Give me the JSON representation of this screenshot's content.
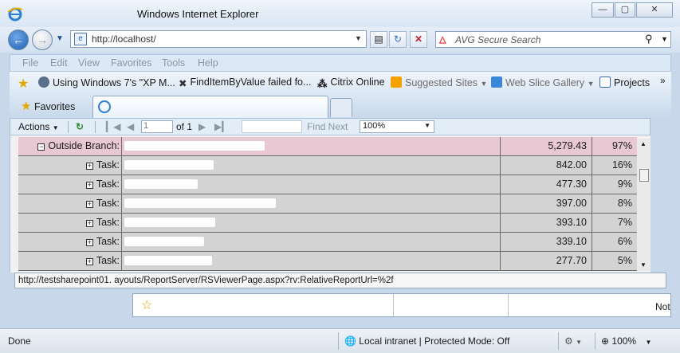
{
  "window": {
    "title": "Windows Internet Explorer"
  },
  "address": {
    "url": "http://localhost/"
  },
  "search": {
    "placeholder": "AVG Secure Search"
  },
  "menu": [
    "File",
    "Edit",
    "View",
    "Favorites",
    "Tools",
    "Help"
  ],
  "favorites_bar": [
    {
      "label": "Using Windows 7's \"XP M...",
      "icon": "wordpress-icon"
    },
    {
      "label": "FindItemByValue failed fo...",
      "icon": "cross-icon"
    },
    {
      "label": "Citrix Online",
      "icon": "citrix-icon"
    },
    {
      "label": "Suggested Sites",
      "icon": "suggested-sites-icon"
    },
    {
      "label": "Web Slice Gallery",
      "icon": "web-slice-icon"
    },
    {
      "label": "Projects",
      "icon": "page-icon"
    }
  ],
  "favorites_button": "Favorites",
  "report_toolbar": {
    "actions": "Actions",
    "page_value": "1",
    "of_pages": "of 1",
    "find_next": "Find Next",
    "zoom": "100%"
  },
  "report": {
    "rows": [
      {
        "label": "Outside Branch:",
        "amount": "5,279.43",
        "percent": "97%",
        "kind": "branch"
      },
      {
        "label": "Task:",
        "amount": "842.00",
        "percent": "16%",
        "kind": "task"
      },
      {
        "label": "Task:",
        "amount": "477.30",
        "percent": "9%",
        "kind": "task"
      },
      {
        "label": "Task:",
        "amount": "397.00",
        "percent": "8%",
        "kind": "task"
      },
      {
        "label": "Task:",
        "amount": "393.10",
        "percent": "7%",
        "kind": "task"
      },
      {
        "label": "Task:",
        "amount": "339.10",
        "percent": "6%",
        "kind": "task"
      },
      {
        "label": "Task:",
        "amount": "277.70",
        "percent": "5%",
        "kind": "task"
      }
    ]
  },
  "status_url": "http://testsharepoint01.                                               ayouts/ReportServer/RSViewerPage.aspx?rv:RelativeReportUrl=%2f",
  "lower": {
    "truncated_text": "Not"
  },
  "statusbar": {
    "done": "Done",
    "zone": "Local intranet | Protected Mode: Off",
    "zoom": "100%"
  }
}
